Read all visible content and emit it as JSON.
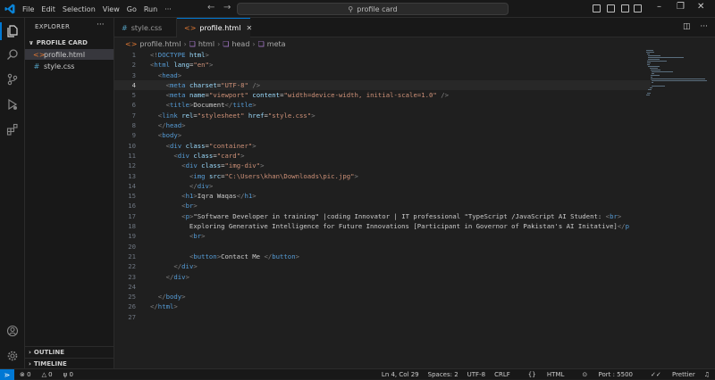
{
  "menu": [
    "File",
    "Edit",
    "Selection",
    "View",
    "Go",
    "Run",
    "···"
  ],
  "search": {
    "text": "profile card"
  },
  "sidebar": {
    "title": "EXPLORER",
    "more": "···",
    "folder": "PROFILE CARD",
    "files": [
      {
        "name": "profile.html",
        "icon": "<>"
      },
      {
        "name": "style.css",
        "icon": "#"
      }
    ],
    "outline": "OUTLINE",
    "timeline": "TIMELINE"
  },
  "tabs": [
    {
      "label": "style.css",
      "icon": "#"
    },
    {
      "label": "profile.html",
      "icon": "<>",
      "close": "✕"
    }
  ],
  "breadcrumb": [
    "profile.html",
    "html",
    "head",
    "meta"
  ],
  "line_numbers": [
    "1",
    "2",
    "3",
    "4",
    "5",
    "6",
    "7",
    "8",
    "9",
    "10",
    "11",
    "12",
    "13",
    "14",
    "15",
    "16",
    "17",
    "18",
    "19",
    "20",
    "21",
    "22",
    "23",
    "24",
    "25",
    "26",
    "27"
  ],
  "code": [
    "<!DOCTYPE html>",
    "<html lang=\"en\">",
    "  <head>",
    "    <meta charset=\"UTF-8\" />",
    "    <meta name=\"viewport\" content=\"width=device-width, initial-scale=1.0\" />",
    "    <title>Document</title>",
    "  <link rel=\"stylesheet\" href=\"style.css\">",
    "  </head>",
    "  <body>",
    "    <div class=\"container\">",
    "      <div class=\"card\">",
    "        <div class=\"img-div\">",
    "          <img src=\"C:\\Users\\khan\\Downloads\\pic.jpg\">",
    "          </div>",
    "        <h1>Iqra Waqas</h1>",
    "        <br>",
    "        <p>\"Software Developer in training\" |coding Innovator | IT professional \"TypeScript /JavaScript AI Student: <br>",
    "          Exploring Generative Intelligence for Future Innovations [Participant in Governor of Pakistan's AI Initative]</p",
    "          <br>",
    "",
    "          <button>Contact Me </button>",
    "      </div>",
    "    </div>",
    "",
    "  </body>",
    "</html>",
    ""
  ],
  "status": {
    "errors": "0",
    "warnings": "0",
    "ports": "0",
    "position": "Ln 4, Col 29",
    "spaces": "Spaces: 2",
    "encoding": "UTF-8",
    "eol": "CRLF",
    "language": "HTML",
    "port": "Port : 5500",
    "prettier": "Prettier"
  }
}
